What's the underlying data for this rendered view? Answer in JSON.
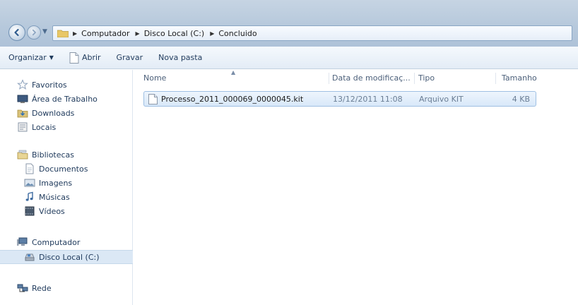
{
  "address": {
    "crumbs": [
      "Computador",
      "Disco Local (C:)",
      "Concluido"
    ]
  },
  "toolbar": {
    "organize": "Organizar",
    "open": "Abrir",
    "burn": "Gravar",
    "new_folder": "Nova pasta"
  },
  "nav": {
    "favorites": "Favoritos",
    "desktop": "Área de Trabalho",
    "downloads": "Downloads",
    "places": "Locais",
    "libraries": "Bibliotecas",
    "documents": "Documentos",
    "images": "Imagens",
    "music": "Músicas",
    "videos": "Vídeos",
    "computer": "Computador",
    "local_disk": "Disco Local (C:)",
    "network": "Rede"
  },
  "columns": {
    "name": "Nome",
    "date": "Data de modificaç...",
    "type": "Tipo",
    "size": "Tamanho"
  },
  "files": [
    {
      "name": "Processo_2011_000069_0000045.kit",
      "date": "13/12/2011 11:08",
      "type": "Arquivo KIT",
      "size": "4 KB"
    }
  ],
  "colors": {
    "accent": "#1e395b",
    "selection": "#d8e8f9"
  }
}
